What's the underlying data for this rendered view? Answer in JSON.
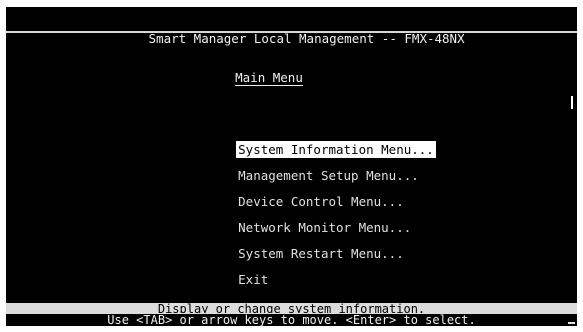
{
  "header": {
    "title": "Smart Manager Local Management -- FMX-48NX"
  },
  "main": {
    "heading": "Main Menu",
    "items": [
      {
        "label": "System Information Menu...",
        "selected": true
      },
      {
        "label": "Management Setup Menu...",
        "selected": false
      },
      {
        "label": "Device Control Menu...",
        "selected": false
      },
      {
        "label": "Network Monitor Menu...",
        "selected": false
      },
      {
        "label": "System Restart Menu...",
        "selected": false
      },
      {
        "label": "Exit",
        "selected": false
      }
    ]
  },
  "status": {
    "description": "Display or change system information.",
    "help": "Use <TAB> or arrow keys to move. <Enter> to select."
  },
  "colors": {
    "background": "#000000",
    "foreground": "#e0e0e0",
    "highlight": "#ffffff",
    "status_bar": "#dcdcdc"
  }
}
